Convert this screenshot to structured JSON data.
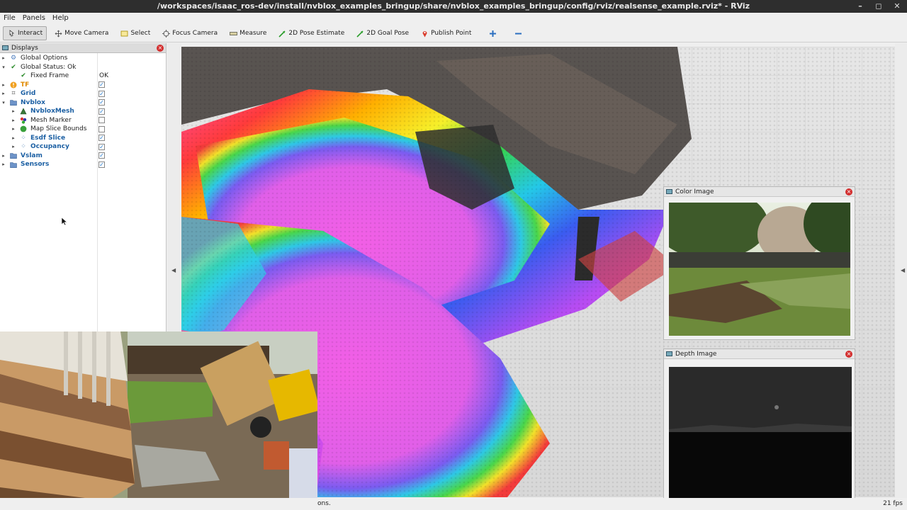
{
  "window": {
    "title": "/workspaces/isaac_ros-dev/install/nvblox_examples_bringup/share/nvblox_examples_bringup/config/rviz/realsense_example.rviz* - RViz",
    "controls": [
      "–",
      "◻",
      "✕"
    ]
  },
  "menu": [
    "File",
    "Panels",
    "Help"
  ],
  "toolbar": [
    {
      "label": "Interact",
      "icon": "interact-icon"
    },
    {
      "label": "Move Camera",
      "icon": "move-camera-icon"
    },
    {
      "label": "Select",
      "icon": "select-icon"
    },
    {
      "label": "Focus Camera",
      "icon": "focus-camera-icon"
    },
    {
      "label": "Measure",
      "icon": "measure-icon"
    },
    {
      "label": "2D Pose Estimate",
      "icon": "pose-estimate-icon"
    },
    {
      "label": "2D Goal Pose",
      "icon": "goal-pose-icon"
    },
    {
      "label": "Publish Point",
      "icon": "publish-point-icon"
    }
  ],
  "displays": {
    "title": "Displays",
    "items": [
      {
        "label": "Global Options",
        "value": ""
      },
      {
        "label": "Global Status: Ok",
        "value": ""
      },
      {
        "label": "Fixed Frame",
        "value": "OK"
      },
      {
        "label": "TF",
        "value": ""
      },
      {
        "label": "Grid",
        "value": ""
      },
      {
        "label": "Nvblox",
        "value": ""
      },
      {
        "label": "NvbloxMesh",
        "value": ""
      },
      {
        "label": "Mesh Marker",
        "value": ""
      },
      {
        "label": "Map Slice Bounds",
        "value": ""
      },
      {
        "label": "Esdf Slice",
        "value": ""
      },
      {
        "label": "Occupancy",
        "value": ""
      },
      {
        "label": "Vslam",
        "value": ""
      },
      {
        "label": "Sensors",
        "value": ""
      }
    ]
  },
  "color_image": {
    "title": "Color Image"
  },
  "depth_image": {
    "title": "Depth Image"
  },
  "status_bar": {
    "message": "ons.",
    "fps": "21 fps"
  }
}
